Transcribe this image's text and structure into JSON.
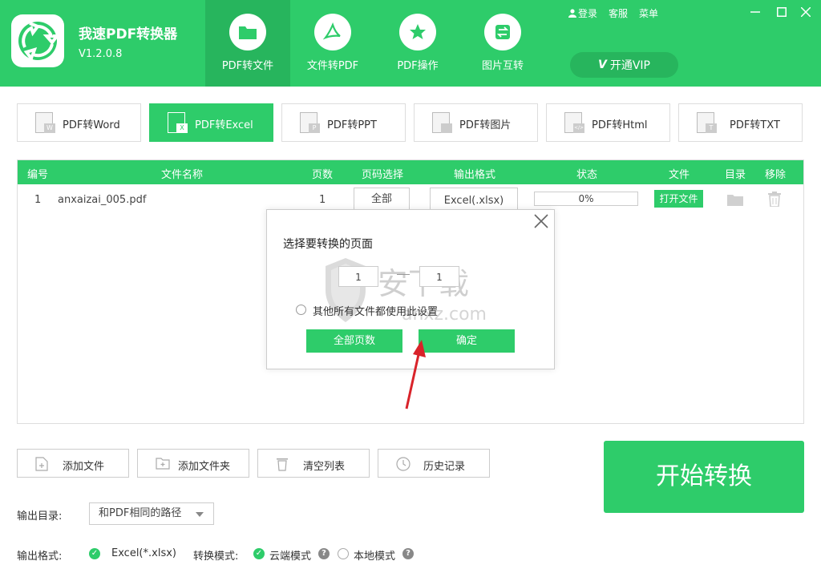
{
  "app": {
    "name": "我速PDF转换器",
    "version": "V1.2.0.8"
  },
  "top_links": {
    "login": "登录",
    "service": "客服",
    "menu": "菜单"
  },
  "nav_tabs": [
    {
      "label": "PDF转文件",
      "icon": "folder-icon"
    },
    {
      "label": "文件转PDF",
      "icon": "pdf-icon"
    },
    {
      "label": "PDF操作",
      "icon": "star-icon"
    },
    {
      "label": "图片互转",
      "icon": "swap-icon"
    }
  ],
  "vip": {
    "mark": "V",
    "label": "开通VIP"
  },
  "format_tabs": [
    {
      "label": "PDF转Word",
      "badge": "W"
    },
    {
      "label": "PDF转Excel",
      "badge": "X"
    },
    {
      "label": "PDF转PPT",
      "badge": "P"
    },
    {
      "label": "PDF转图片",
      "badge": ""
    },
    {
      "label": "PDF转Html",
      "badge": "</>"
    },
    {
      "label": "PDF转TXT",
      "badge": "T"
    }
  ],
  "table": {
    "headers": [
      "编号",
      "文件名称",
      "页数",
      "页码选择",
      "输出格式",
      "状态",
      "文件",
      "目录",
      "移除"
    ],
    "rows": [
      {
        "index": "1",
        "filename": "anxaizai_005.pdf",
        "pages": "1",
        "page_select": "全部",
        "output_format": "Excel(.xlsx)",
        "status": "0%",
        "open_file": "打开文件"
      }
    ]
  },
  "dialog": {
    "title": "选择要转换的页面",
    "from_page": "1",
    "to_page": "1",
    "apply_all_label": "其他所有文件都使用此设置",
    "all_pages_button": "全部页数",
    "confirm_button": "确定",
    "watermark_text": "安下载",
    "watermark_domain": "anxz.com"
  },
  "actions": {
    "add_file": "添加文件",
    "add_folder": "添加文件夹",
    "clear_list": "清空列表",
    "history": "历史记录",
    "start": "开始转换"
  },
  "settings": {
    "output_dir_label": "输出目录:",
    "output_dir_value": "和PDF相同的路径",
    "output_format_label": "输出格式:",
    "output_format_value": "Excel(*.xlsx)",
    "mode_label": "转换模式:",
    "cloud_mode": "云端模式",
    "local_mode": "本地模式"
  },
  "colors": {
    "brand": "#2ecc6a",
    "brand_dark": "#27b55d",
    "annotation_arrow": "#d9232a"
  }
}
